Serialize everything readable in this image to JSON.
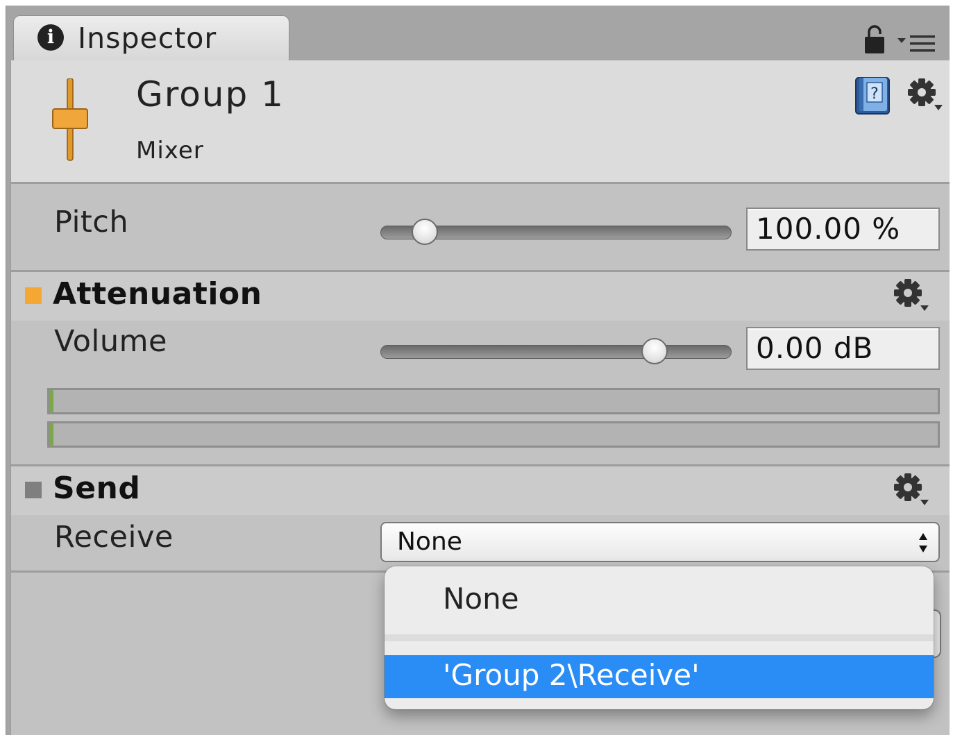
{
  "tab": {
    "icon": "info-icon",
    "icon_glyph": "i",
    "label": "Inspector"
  },
  "toolbar": {
    "lock_icon": "lock-icon",
    "menu_icon": "tab-menu-icon"
  },
  "header": {
    "title": "Group 1",
    "subtitle": "Mixer",
    "icon": "mixer-fader-icon",
    "help_icon": "help-book-icon",
    "settings_icon": "gear-icon"
  },
  "pitch": {
    "label": "Pitch",
    "value": "100.00 %",
    "slider_level": 0.12
  },
  "attenuation": {
    "title": "Attenuation",
    "color": "#f4a833",
    "settings_icon": "gear-icon",
    "volume": {
      "label": "Volume",
      "value": "0.00 dB",
      "slider_level": 0.78
    },
    "meters": [
      {
        "level": 0.005
      },
      {
        "level": 0.005
      }
    ]
  },
  "send": {
    "title": "Send",
    "color": "#7f7f7f",
    "settings_icon": "gear-icon",
    "receive": {
      "label": "Receive",
      "value": "None"
    }
  },
  "dropdown": {
    "options": [
      "None",
      "'Group 2\\Receive'"
    ],
    "highlighted_index": 1,
    "highlight_color": "#2a8cf5"
  }
}
